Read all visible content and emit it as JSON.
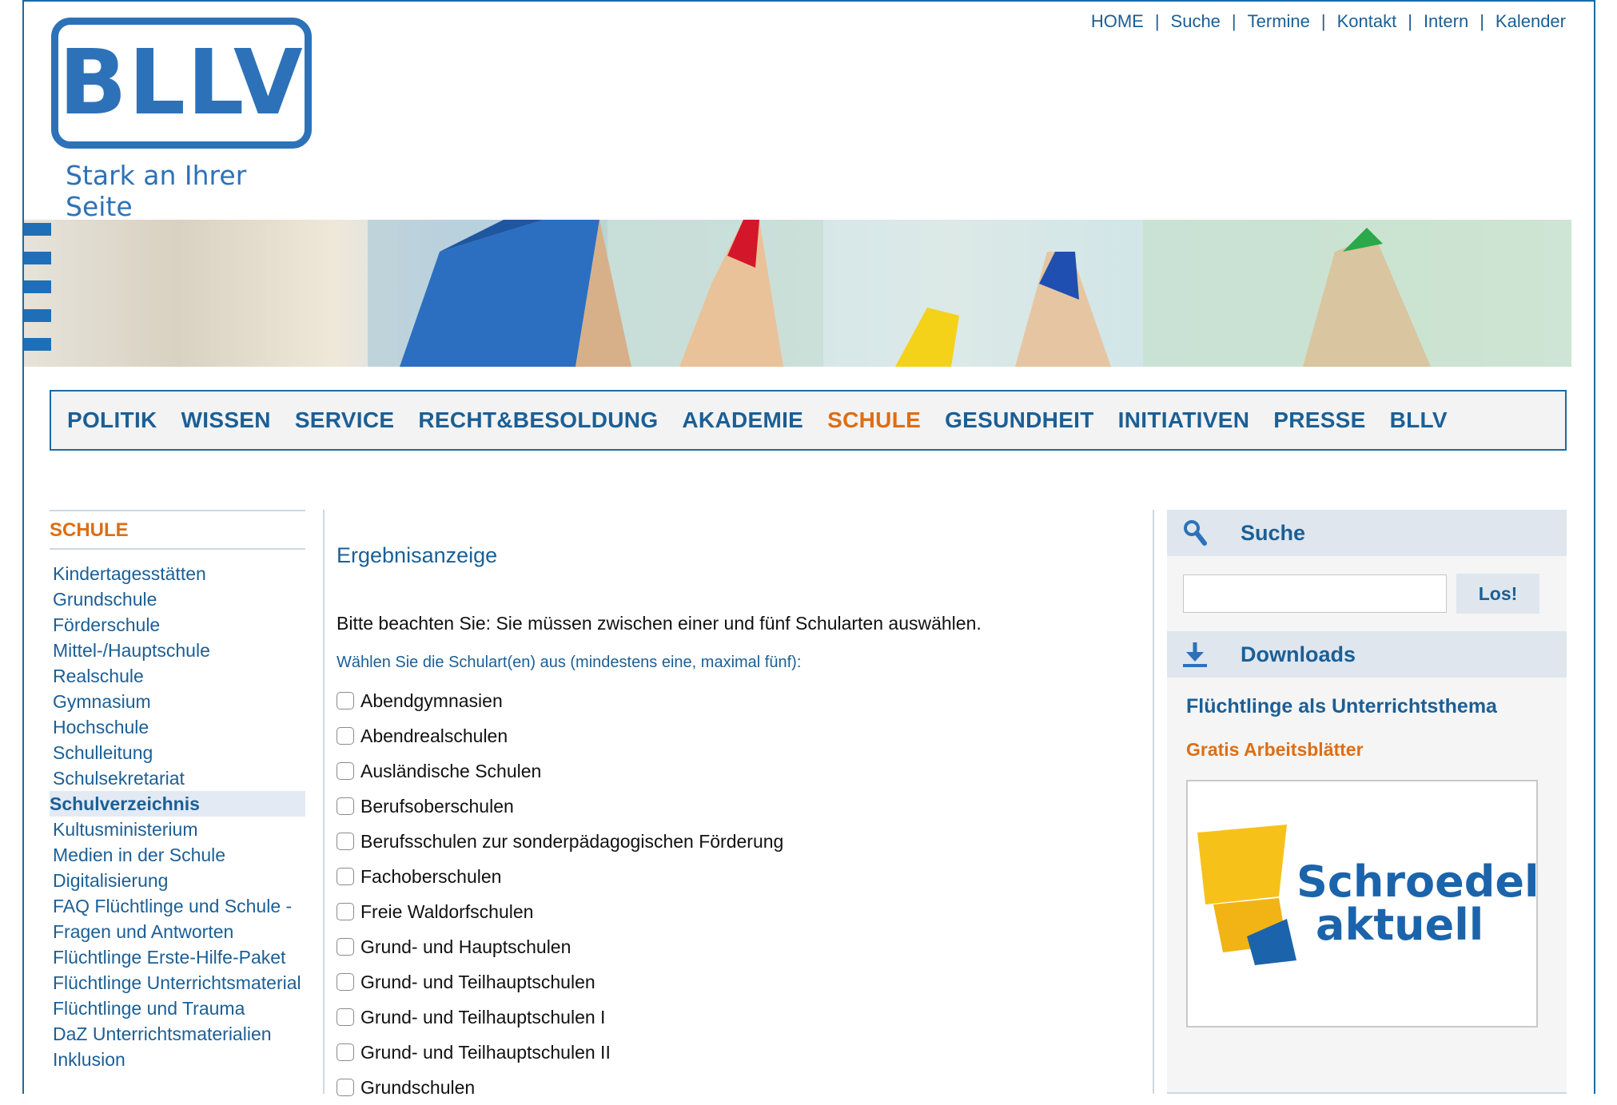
{
  "logo": {
    "text": "BLLV",
    "tagline": "Stark an Ihrer Seite"
  },
  "topnav": [
    "HOME",
    "Suche",
    "Termine",
    "Kontakt",
    "Intern",
    "Kalender"
  ],
  "mainnav": {
    "items": [
      "POLITIK",
      "WISSEN",
      "SERVICE",
      "RECHT&BESOLDUNG",
      "AKADEMIE",
      "SCHULE",
      "GESUNDHEIT",
      "INITIATIVEN",
      "PRESSE",
      "BLLV"
    ],
    "active": "SCHULE"
  },
  "sidebar": {
    "title": "SCHULE",
    "items": [
      "Kindertagesstätten",
      "Grundschule",
      "Förderschule",
      "Mittel-/Hauptschule",
      "Realschule",
      "Gymnasium",
      "Hochschule",
      "Schulleitung",
      "Schulsekretariat",
      "Schulverzeichnis",
      "Kultusministerium",
      "Medien in der Schule",
      "Digitalisierung",
      "FAQ Flüchtlinge und Schule - Fragen und Antworten",
      "Flüchtlinge Erste-Hilfe-Paket",
      "Flüchtlinge Unterrichtsmaterial",
      "Flüchtlinge und Trauma",
      "DaZ Unterrichtsmaterialien",
      "Inklusion"
    ],
    "active": "Schulverzeichnis"
  },
  "content": {
    "heading": "Ergebnisanzeige",
    "notice": "Bitte beachten Sie: Sie müssen zwischen einer und fünf Schularten auswählen.",
    "instruction": "Wählen Sie die Schulart(en) aus (mindestens eine, maximal fünf):",
    "school_types": [
      "Abendgymnasien",
      "Abendrealschulen",
      "Ausländische Schulen",
      "Berufsoberschulen",
      "Berufsschulen zur sonderpädagogischen Förderung",
      "Fachoberschulen",
      "Freie Waldorfschulen",
      "Grund- und Hauptschulen",
      "Grund- und Teilhauptschulen",
      "Grund- und Teilhauptschulen I",
      "Grund- und Teilhauptschulen II",
      "Grundschulen"
    ]
  },
  "right": {
    "search": {
      "label": "Suche",
      "button": "Los!",
      "icon": "search-icon"
    },
    "downloads": {
      "label": "Downloads",
      "icon": "download-icon",
      "title": "Flüchtlinge als Unterrichtsthema",
      "subtitle": "Gratis Arbeitsblätter",
      "ad_line1": "Schroedel",
      "ad_line2": "aktuell"
    }
  },
  "colors": {
    "link": "#1b5f96",
    "accent": "#dd6e14",
    "brand": "#2d72b8"
  }
}
